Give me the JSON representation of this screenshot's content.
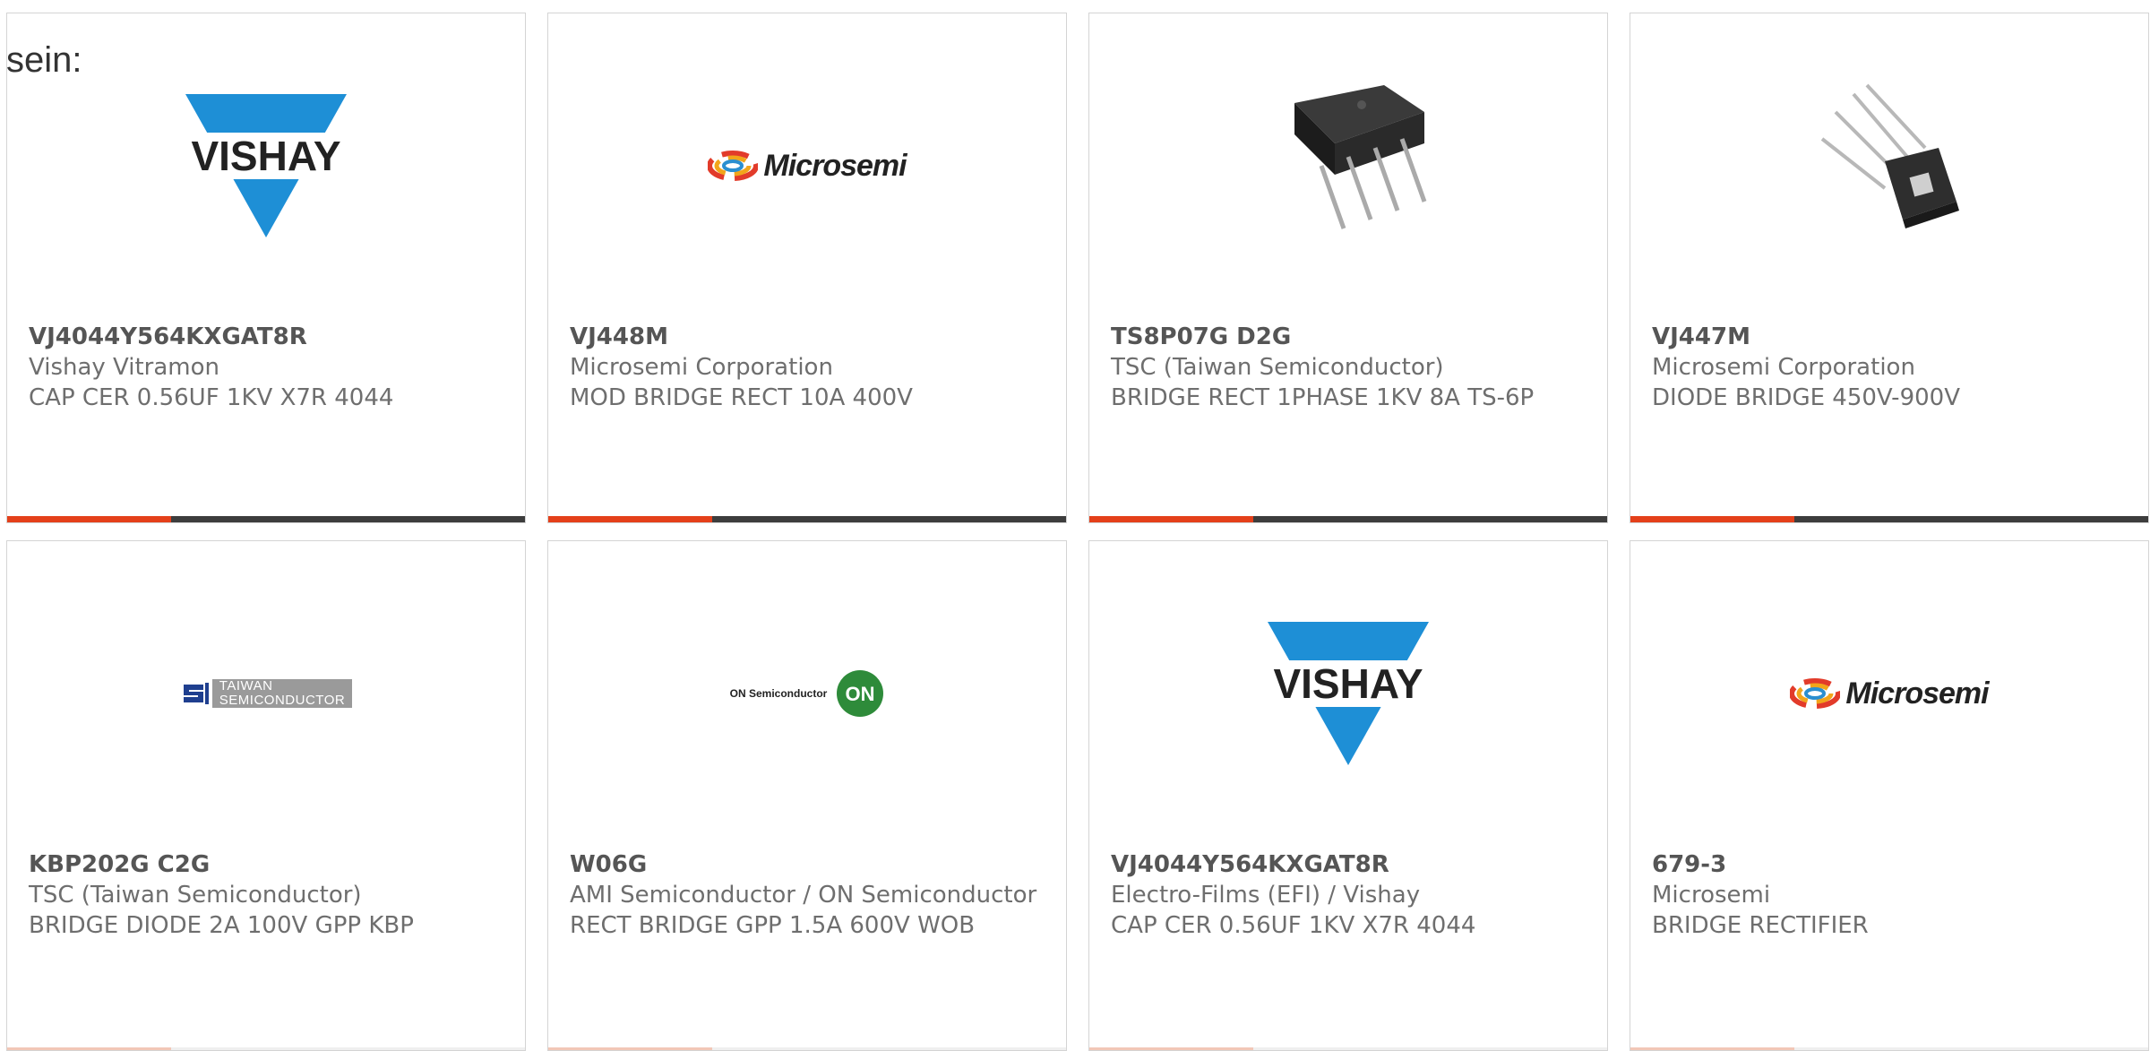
{
  "intro_text": "sein:",
  "colors": {
    "accent": "#e4401a",
    "bar_dark": "#3d3d3d",
    "vishay_blue": "#1e8fd6"
  },
  "products": [
    {
      "part": "VJ4044Y564KXGAT8R",
      "maker": "Vishay Vitramon",
      "desc": "CAP CER 0.56UF 1KV X7R 4044",
      "image": "vishay-logo",
      "logo_text": "VISHAY"
    },
    {
      "part": "VJ448M",
      "maker": "Microsemi Corporation",
      "desc": "MOD BRIDGE RECT 10A 400V",
      "image": "microsemi-logo",
      "logo_text": "Microsemi"
    },
    {
      "part": "TS8P07G D2G",
      "maker": "TSC (Taiwan Semiconductor)",
      "desc": "BRIDGE RECT 1PHASE 1KV 8A TS-6P",
      "image": "bridge-rectifier-photo"
    },
    {
      "part": "VJ447M",
      "maker": "Microsemi Corporation",
      "desc": "DIODE BRIDGE 450V-900V",
      "image": "square-bridge-photo"
    },
    {
      "part": "KBP202G C2G",
      "maker": "TSC (Taiwan Semiconductor)",
      "desc": "BRIDGE DIODE 2A 100V GPP KBP",
      "image": "taiwan-semiconductor-logo",
      "logo_text_1": "TAIWAN",
      "logo_text_2": "SEMICONDUCTOR"
    },
    {
      "part": "W06G",
      "maker": "AMI Semiconductor / ON Semiconductor",
      "desc": "RECT BRIDGE GPP 1.5A 600V WOB",
      "image": "on-semiconductor-logo",
      "logo_text": "ON Semiconductor",
      "badge_text": "ON"
    },
    {
      "part": "VJ4044Y564KXGAT8R",
      "maker": "Electro-Films (EFI) / Vishay",
      "desc": "CAP CER 0.56UF 1KV X7R 4044",
      "image": "vishay-logo",
      "logo_text": "VISHAY"
    },
    {
      "part": "679-3",
      "maker": "Microsemi",
      "desc": "BRIDGE RECTIFIER",
      "image": "microsemi-logo",
      "logo_text": "Microsemi"
    }
  ]
}
